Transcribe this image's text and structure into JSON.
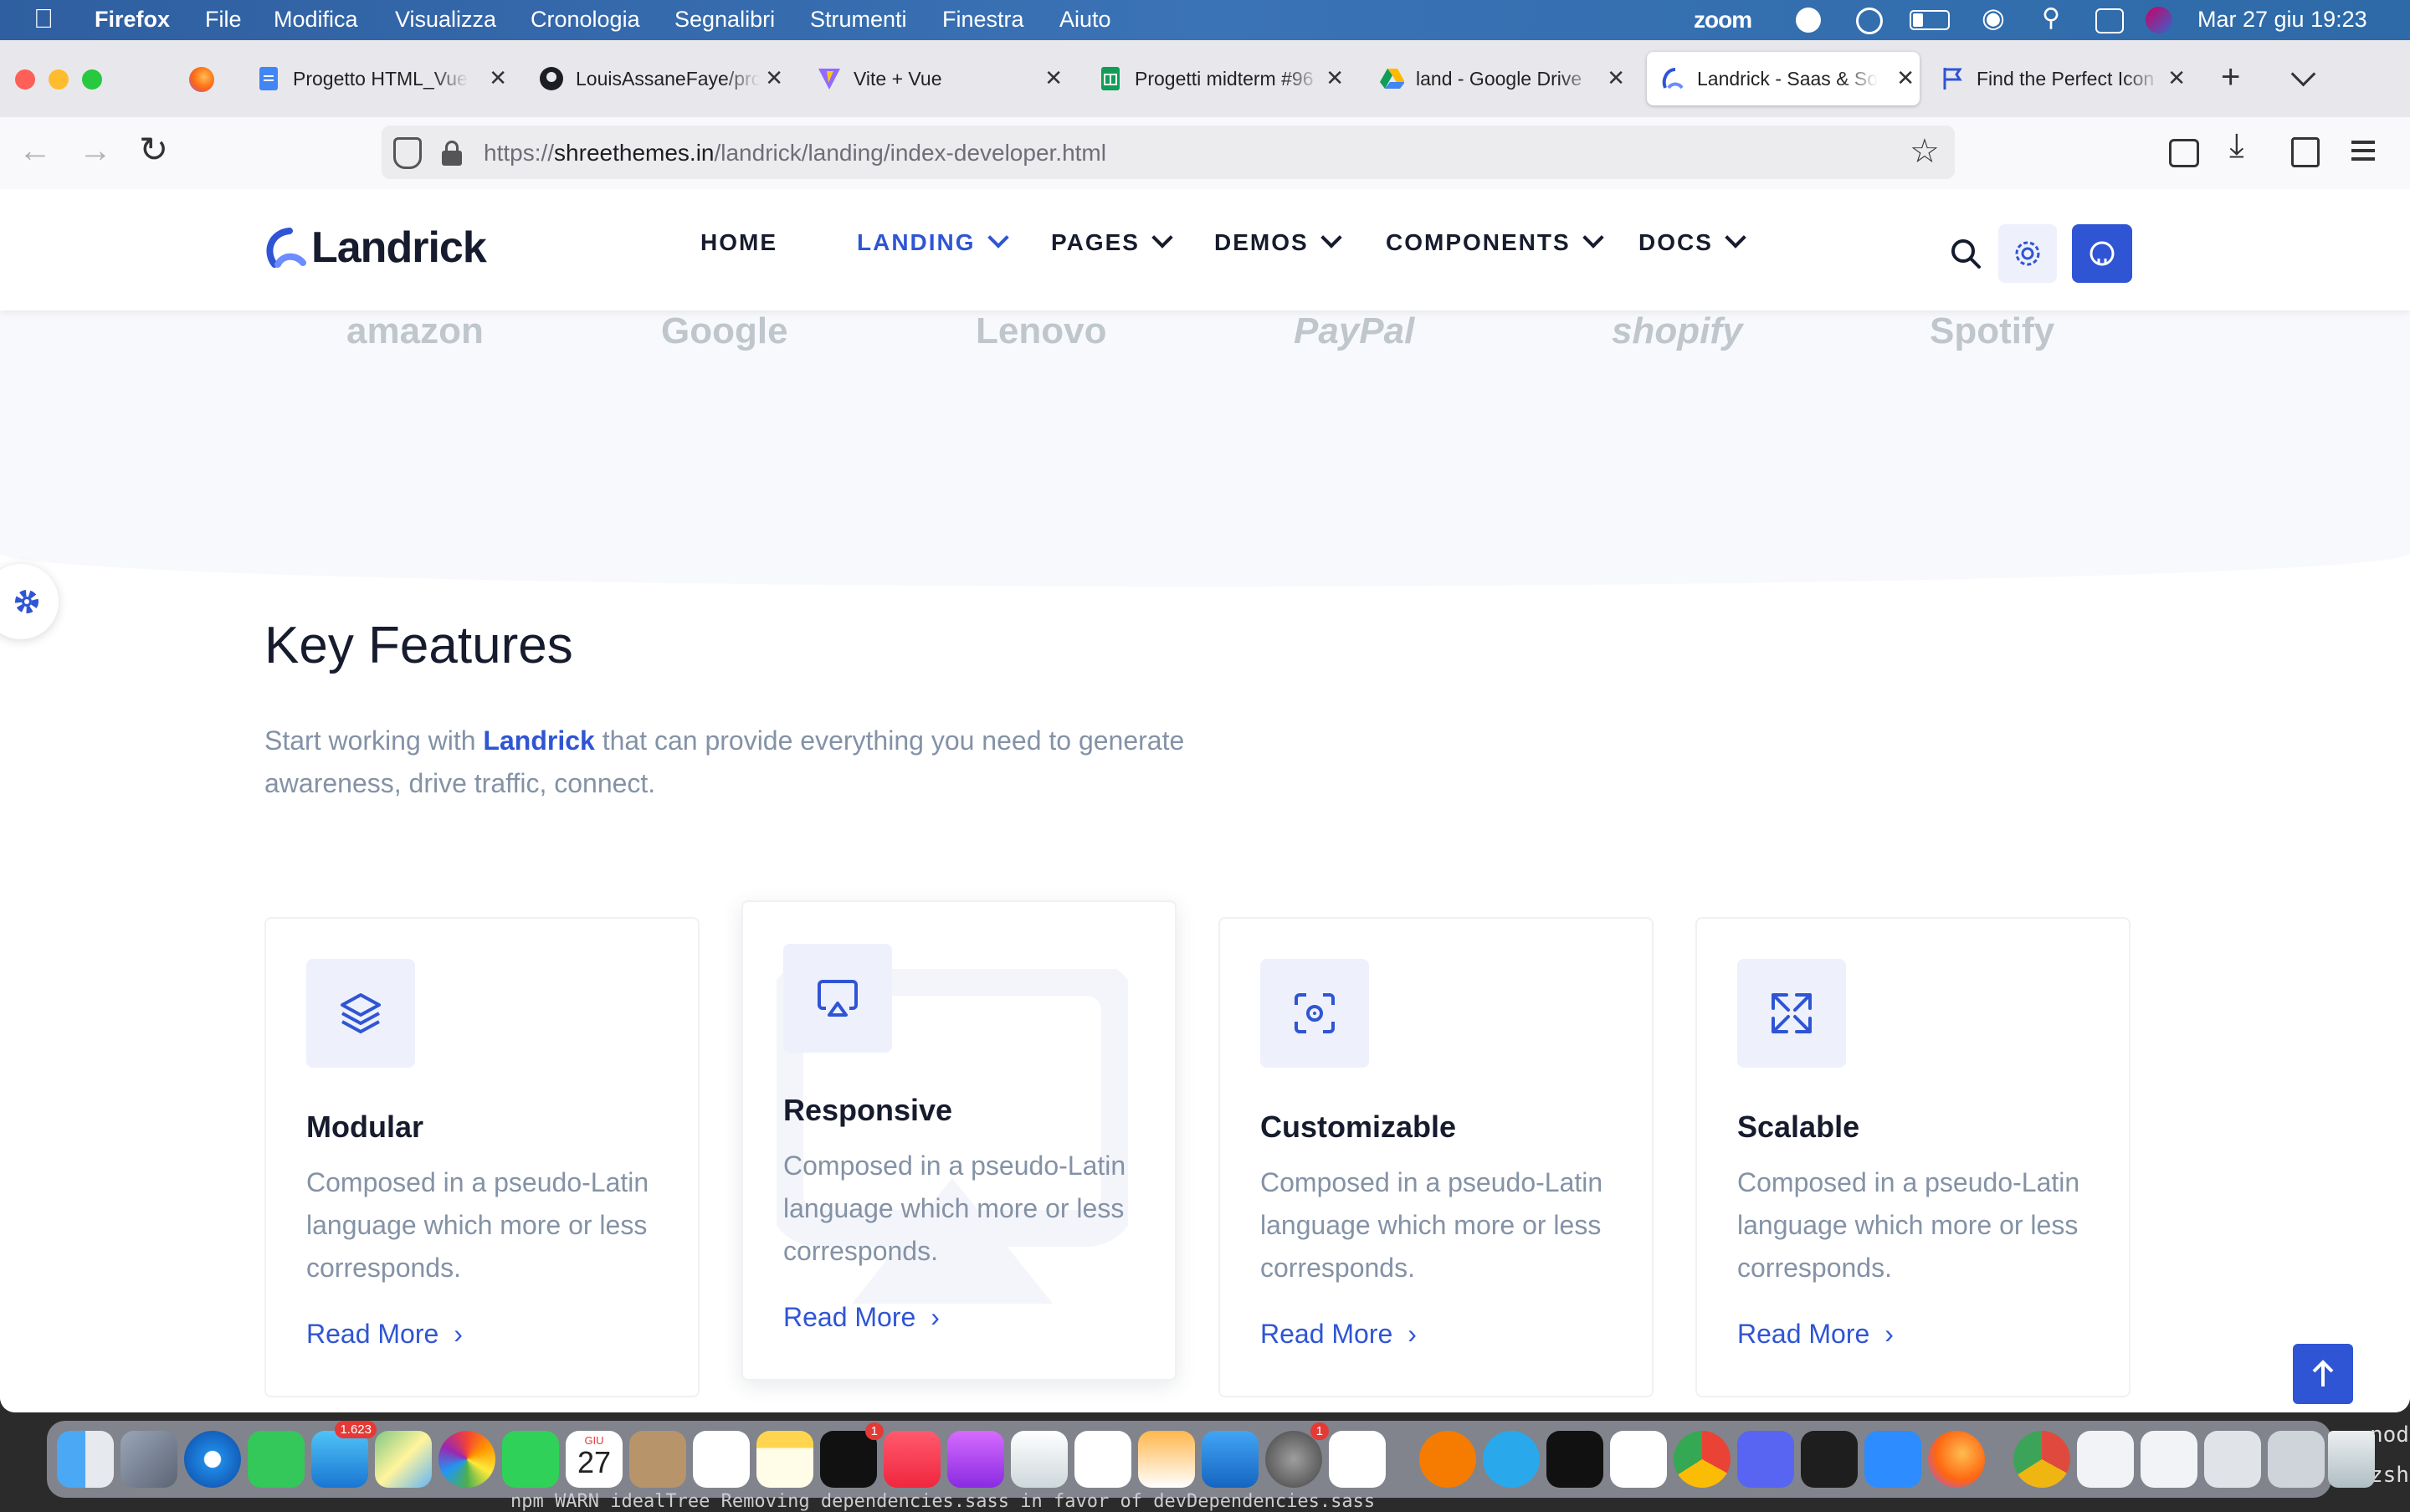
{
  "menubar": {
    "app": "Firefox",
    "items": [
      "File",
      "Modifica",
      "Visualizza",
      "Cronologia",
      "Segnalibri",
      "Strumenti",
      "Finestra",
      "Aiuto"
    ],
    "zoom": "zoom",
    "datetime": "Mar 27 giu  19:23"
  },
  "tabs": [
    {
      "label": "Progetto HTML_Vue.js",
      "icon": "google-docs-icon"
    },
    {
      "label": "LouisAssaneFaye/pro",
      "icon": "github-icon"
    },
    {
      "label": "Vite + Vue",
      "icon": "vite-icon"
    },
    {
      "label": "Progetti midterm #96",
      "icon": "google-sheets-icon"
    },
    {
      "label": "land - Google Drive",
      "icon": "google-drive-icon"
    },
    {
      "label": "Landrick - Saas & So",
      "icon": "landrick-icon"
    },
    {
      "label": "Find the Perfect Icon",
      "icon": "flag-icon"
    }
  ],
  "url": {
    "prefix": "https://",
    "host": "shreethemes.in",
    "path": "/landrick/landing/index-developer.html"
  },
  "site": {
    "logo": "Landrick",
    "nav": [
      "HOME",
      "LANDING",
      "PAGES",
      "DEMOS",
      "COMPONENTS",
      "DOCS"
    ],
    "active_nav": "LANDING"
  },
  "brands": [
    "amazon",
    "Google",
    "Lenovo",
    "PayPal",
    "shopify",
    "Spotify"
  ],
  "features": {
    "title": "Key Features",
    "subtitle_pre": "Start working with ",
    "subtitle_brand": "Landrick",
    "subtitle_post": " that can provide everything you need to generate awareness, drive traffic, connect.",
    "cards": [
      {
        "title": "Modular",
        "desc": "Composed in a pseudo-Latin language which more or less corresponds.",
        "more": "Read More"
      },
      {
        "title": "Responsive",
        "desc": "Composed in a pseudo-Latin language which more or less corresponds.",
        "more": "Read More"
      },
      {
        "title": "Customizable",
        "desc": "Composed in a pseudo-Latin language which more or less corresponds.",
        "more": "Read More"
      },
      {
        "title": "Scalable",
        "desc": "Composed in a pseudo-Latin language which more or less corresponds.",
        "more": "Read More"
      }
    ]
  },
  "dock": {
    "mail_badge": "1.623",
    "calendar_month": "GIU",
    "calendar_day": "27",
    "tv_badge": "1",
    "settings_badge": "1"
  },
  "terminal_peek": {
    "text": "npm WARN idealTree Removing dependencies.sass in favor of devDependencies.sass",
    "side_label": "node",
    "side_label2": "zsh"
  },
  "colors": {
    "primary": "#2f55d4",
    "heading": "#161c2d",
    "muted": "#8492a6",
    "icon_bg": "#eef0fb"
  }
}
